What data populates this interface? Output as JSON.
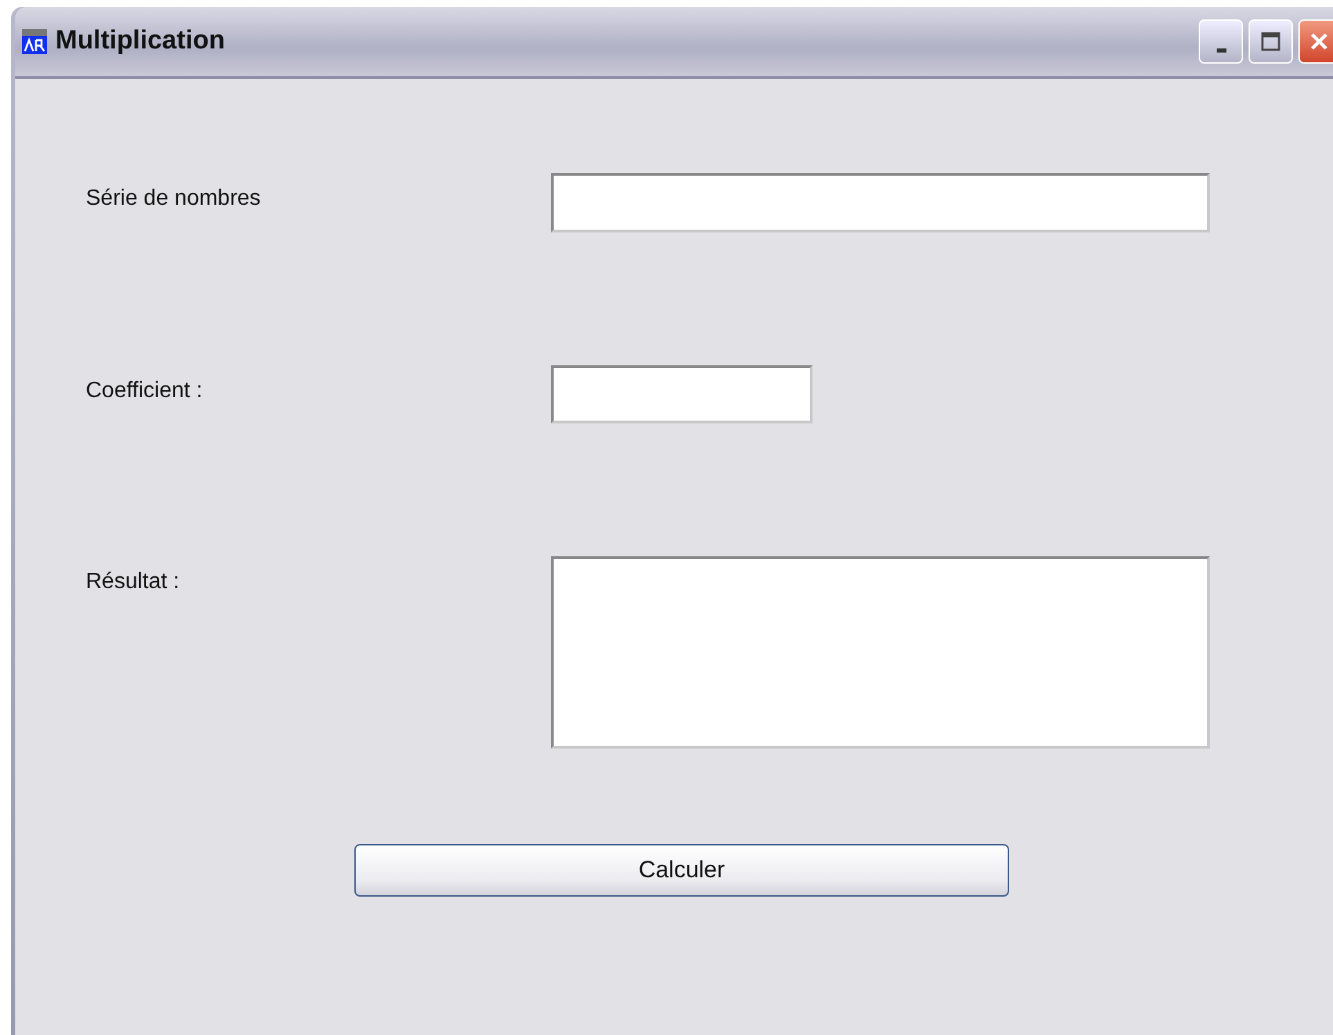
{
  "window": {
    "title": "Multiplication"
  },
  "fields": [
    {
      "label": "Série de nombres",
      "kind": "line"
    },
    {
      "label": "Coefficient :",
      "kind": "short"
    },
    {
      "label": "Résultat :",
      "kind": "area"
    }
  ],
  "button": "Calculer"
}
